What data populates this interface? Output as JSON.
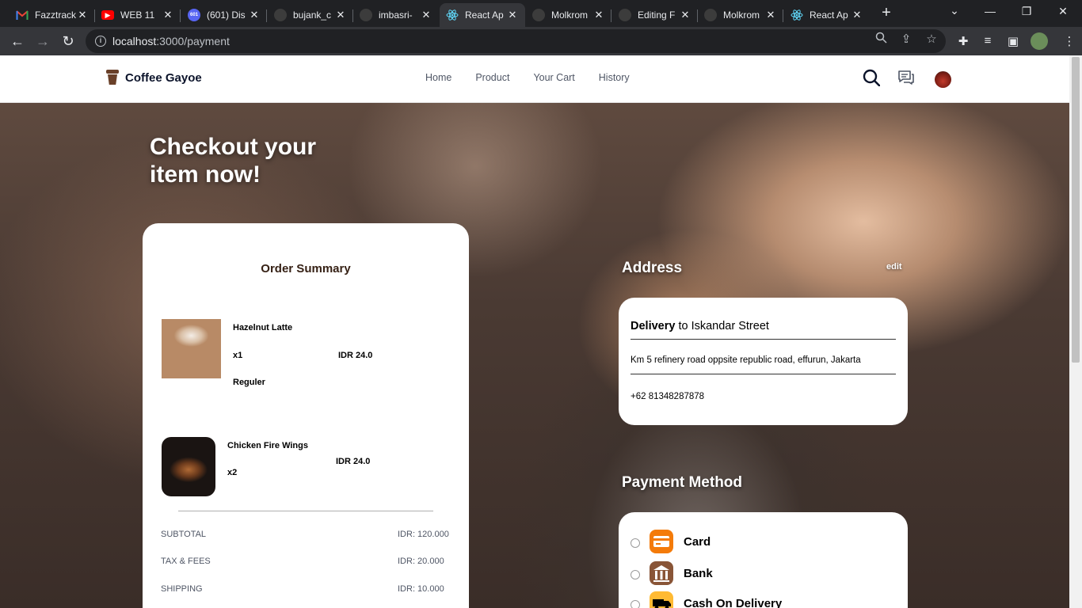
{
  "browser": {
    "tabs": [
      {
        "title": "Fazztrack",
        "icon": "gmail-icon",
        "color": "#ea4335"
      },
      {
        "title": "WEB 11",
        "icon": "youtube-icon",
        "color": "#ff0000"
      },
      {
        "title": "(601) Dis",
        "icon": "discord-icon",
        "color": "#5865f2",
        "badge": "601"
      },
      {
        "title": "bujank_c",
        "icon": "github-icon",
        "color": "#24292f"
      },
      {
        "title": "imbasri-",
        "icon": "github-icon",
        "color": "#24292f"
      },
      {
        "title": "React Ap",
        "icon": "react-icon",
        "color": "#61dafb",
        "active": true
      },
      {
        "title": "Molkrom",
        "icon": "github-icon",
        "color": "#24292f"
      },
      {
        "title": "Editing F",
        "icon": "github-icon",
        "color": "#24292f"
      },
      {
        "title": "Molkrom",
        "icon": "github-icon",
        "color": "#24292f"
      },
      {
        "title": "React Ap",
        "icon": "react-icon",
        "color": "#61dafb"
      }
    ],
    "url_host": "localhost",
    "url_path": ":3000/payment"
  },
  "site": {
    "brand": "Coffee Gayoe",
    "menu": [
      "Home",
      "Product",
      "Your Cart",
      "History"
    ]
  },
  "hero": {
    "title_line1": "Checkout your",
    "title_line2": "item now!"
  },
  "order": {
    "title": "Order Summary",
    "items": [
      {
        "name": "Hazelnut Latte",
        "qty": "x1",
        "price": "IDR 24.0",
        "size": "Reguler"
      },
      {
        "name": "Chicken Fire Wings",
        "qty": "x2",
        "price": "IDR 24.0"
      }
    ],
    "summary": [
      {
        "label": "SUBTOTAL",
        "value": "IDR: 120.000"
      },
      {
        "label": "TAX & FEES",
        "value": "IDR: 20.000"
      },
      {
        "label": "SHIPPING",
        "value": "IDR: 10.000"
      }
    ]
  },
  "address": {
    "title": "Address",
    "edit": "edit",
    "delivery_bold": "Delivery",
    "delivery_rest": " to Iskandar Street",
    "street": "Km 5 refinery road oppsite republic road, effurun, Jakarta",
    "phone": "+62 81348287878"
  },
  "payment": {
    "title": "Payment Method",
    "methods": [
      {
        "label": "Card",
        "icon": "card-icon",
        "color": "#f47b0a"
      },
      {
        "label": "Bank",
        "icon": "bank-icon",
        "color": "#895537"
      },
      {
        "label": "Cash On Delivery",
        "icon": "delivery-icon",
        "color": "#ffba33"
      }
    ]
  }
}
